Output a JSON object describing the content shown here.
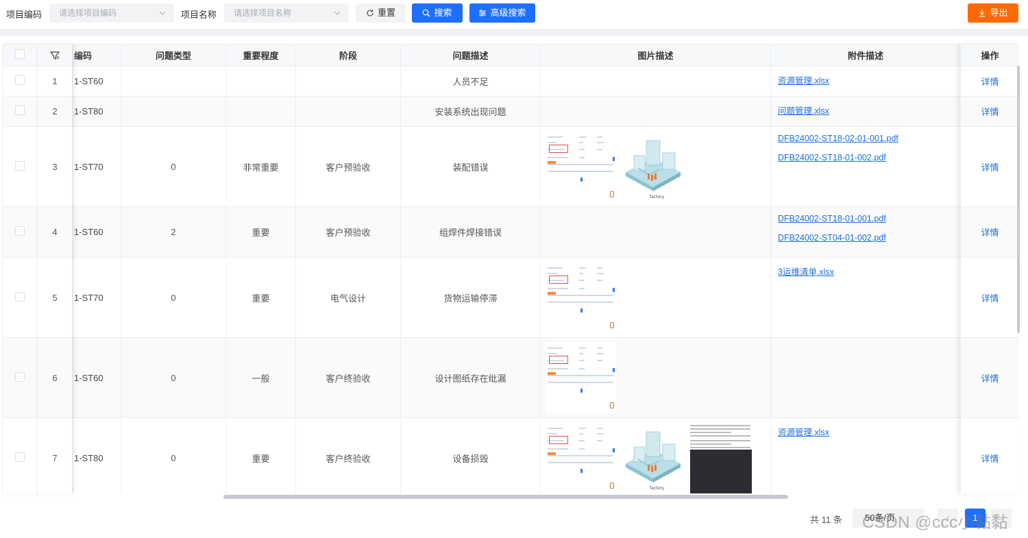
{
  "filters": {
    "project_code_label": "项目编码",
    "project_code_placeholder": "请选择项目编码",
    "project_name_label": "项目名称",
    "project_name_placeholder": "请选择项目名称",
    "reset_label": "重置",
    "search_label": "搜索",
    "advanced_search_label": "高级搜索",
    "export_label": "导出"
  },
  "table": {
    "columns": [
      "编码",
      "问题类型",
      "重要程度",
      "阶段",
      "问题描述",
      "图片描述",
      "附件描述",
      "操作"
    ],
    "detail_label": "详情",
    "rows": [
      {
        "index": "1",
        "code": "1-ST60",
        "type": "",
        "importance": "",
        "stage": "",
        "description": "人员不足",
        "images": [],
        "attachments": [
          "资源管理.xlsx"
        ]
      },
      {
        "index": "2",
        "code": "1-ST80",
        "type": "",
        "importance": "",
        "stage": "",
        "description": "安装系统出现问题",
        "images": [],
        "attachments": [
          "问题管理.xlsx"
        ]
      },
      {
        "index": "3",
        "code": "1-ST70",
        "type": "0",
        "importance": "非常重要",
        "stage": "客户预验收",
        "description": "装配错误",
        "images": [
          "screenshot",
          "factory"
        ],
        "attachments": [
          "DFB24002-ST18-02-01-001.pdf",
          "DFB24002-ST18-01-002.pdf"
        ]
      },
      {
        "index": "4",
        "code": "1-ST60",
        "type": "2",
        "importance": "重要",
        "stage": "客户预验收",
        "description": "组焊件焊接错误",
        "images": [],
        "attachments": [
          "DFB24002-ST18-01-001.pdf",
          "DFB24002-ST04-01-002.pdf"
        ]
      },
      {
        "index": "5",
        "code": "1-ST70",
        "type": "0",
        "importance": "重要",
        "stage": "电气设计",
        "description": "货物运输停滞",
        "images": [
          "screenshot"
        ],
        "attachments": [
          "3运维清单.xlsx"
        ]
      },
      {
        "index": "6",
        "code": "1-ST60",
        "type": "0",
        "importance": "一般",
        "stage": "客户终验收",
        "description": "设计图纸存在纰漏",
        "images": [
          "screenshot"
        ],
        "attachments": []
      },
      {
        "index": "7",
        "code": "1-ST80",
        "type": "0",
        "importance": "重要",
        "stage": "客户终验收",
        "description": "设备损毁",
        "images": [
          "screenshot",
          "factory",
          "document"
        ],
        "attachments": [
          "资源管理.xlsx"
        ]
      }
    ]
  },
  "factory_caption": "factory",
  "pagination": {
    "total_label": "共 11 条",
    "page_size_label": "50条/页",
    "current_page": "1"
  },
  "watermark": "CSDN @ccc小黏黏",
  "colors": {
    "primary": "#1f6fff",
    "export": "#ff6a00",
    "link": "#1a6fe8"
  }
}
